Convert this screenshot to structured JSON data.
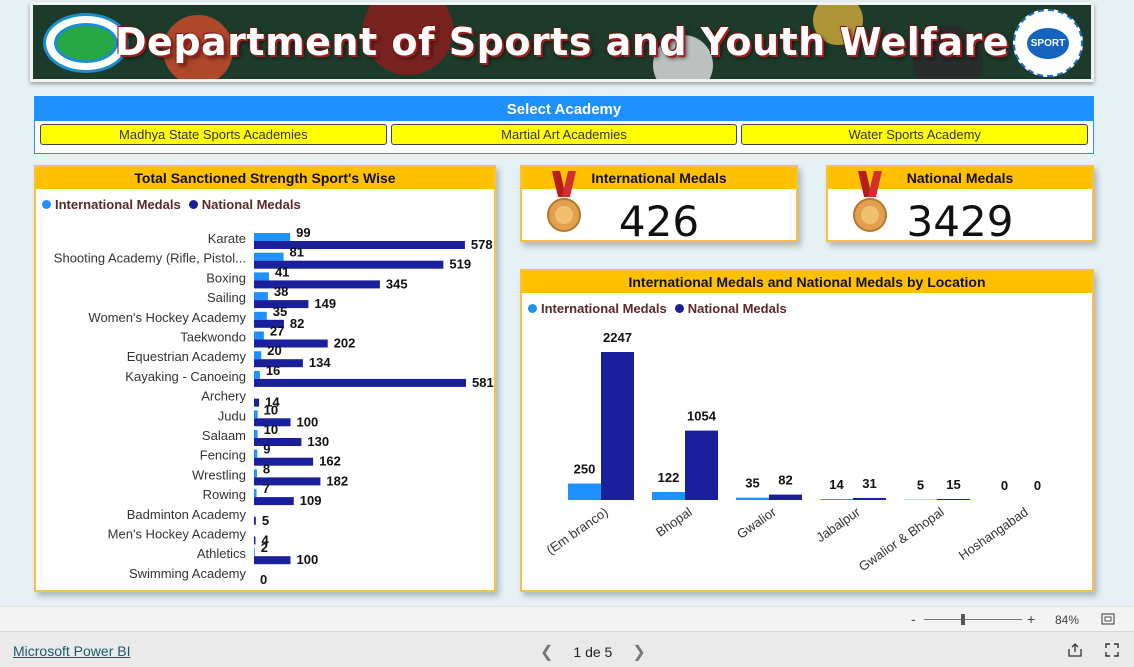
{
  "banner": {
    "title": "Department of Sports and Youth Welfare",
    "right_logo_text": "SPORT"
  },
  "selector": {
    "title": "Select Academy",
    "buttons": [
      "Madhya State Sports Academies",
      "Martial Art Academies",
      "Water Sports Academy"
    ]
  },
  "colors": {
    "international": "#1e90ff",
    "national": "#1a1f9c",
    "header": "#ffc000",
    "selector": "#1e90ff",
    "button": "#ffff00"
  },
  "kpi": {
    "international": {
      "title": "International Medals",
      "value": "426",
      "icon": "medal-icon"
    },
    "national": {
      "title": "National Medals",
      "value": "3429",
      "icon": "medal-icon"
    }
  },
  "legend": {
    "international": "International Medals",
    "national": "National Medals"
  },
  "chart_data": [
    {
      "type": "bar",
      "orientation": "horizontal",
      "title": "Total Sanctioned Strength Sport's Wise",
      "legend_position": "top-left",
      "categories": [
        "Karate",
        "Shooting Academy (Rifle, Pistol...",
        "Boxing",
        "Sailing",
        "Women's Hockey Academy",
        "Taekwondo",
        "Equestrian Academy",
        "Kayaking - Canoeing",
        "Archery",
        "Judu",
        "Salaam",
        "Fencing",
        "Wrestling",
        "Rowing",
        "Badminton Academy",
        "Men's Hockey Academy",
        "Athletics",
        "Swimming Academy"
      ],
      "series": [
        {
          "name": "International Medals",
          "values": [
            99,
            81,
            41,
            38,
            35,
            27,
            20,
            16,
            0,
            10,
            10,
            9,
            8,
            7,
            0,
            0,
            2,
            0
          ]
        },
        {
          "name": "National Medals",
          "values": [
            578,
            519,
            345,
            149,
            82,
            202,
            134,
            581,
            14,
            100,
            130,
            162,
            182,
            109,
            5,
            4,
            100,
            0
          ]
        }
      ]
    },
    {
      "type": "bar",
      "title": "International Medals and National Medals by Location",
      "legend_position": "top-left",
      "categories": [
        "(Em branco)",
        "Bhopal",
        "Gwalior",
        "Jabalpur",
        "Gwalior & Bhopal",
        "Hoshangabad"
      ],
      "series": [
        {
          "name": "International Medals",
          "values": [
            250,
            122,
            35,
            14,
            5,
            0
          ]
        },
        {
          "name": "National Medals",
          "values": [
            2247,
            1054,
            82,
            31,
            15,
            0
          ]
        }
      ]
    }
  ],
  "zoom": {
    "minus": "-",
    "plus": "+",
    "level": "84%"
  },
  "footer": {
    "link": "Microsoft Power BI",
    "page_indicator": "1 de 5"
  }
}
